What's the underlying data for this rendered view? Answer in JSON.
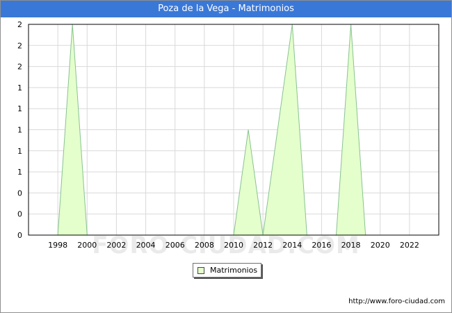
{
  "window": {
    "title": "Poza de la Vega - Matrimonios"
  },
  "watermark": "FORO-CIUDAD.COM",
  "source": "http://www.foro-ciudad.com",
  "colors": {
    "title_bar": "#3a78d8",
    "fill": "#e4ffcc",
    "line": "#88c291",
    "grid": "#d9d9d9"
  },
  "chart_data": {
    "type": "area",
    "title": "Poza de la Vega - Matrimonios",
    "xlabel": "",
    "ylabel": "",
    "x": [
      1996,
      1997,
      1998,
      1999,
      2000,
      2001,
      2002,
      2003,
      2004,
      2005,
      2006,
      2007,
      2008,
      2009,
      2010,
      2011,
      2012,
      2013,
      2014,
      2015,
      2016,
      2017,
      2018,
      2019,
      2020,
      2021,
      2022,
      2023
    ],
    "series": [
      {
        "name": "Matrimonios",
        "values": [
          null,
          null,
          0,
          2,
          0,
          null,
          null,
          null,
          null,
          null,
          null,
          null,
          null,
          null,
          0,
          1,
          0,
          1,
          2,
          0,
          null,
          0,
          2,
          0,
          null,
          null,
          null,
          null
        ]
      }
    ],
    "xlim": [
      1996,
      2024
    ],
    "ylim": [
      0,
      2
    ],
    "x_ticks": [
      "1998",
      "2000",
      "2002",
      "2004",
      "2006",
      "2008",
      "2010",
      "2012",
      "2014",
      "2016",
      "2018",
      "2020",
      "2022"
    ],
    "y_tick_labels": [
      "0",
      "0",
      "0",
      "1",
      "1",
      "1",
      "1",
      "1",
      "2",
      "2",
      "2"
    ],
    "grid": true,
    "legend": {
      "position": "bottom-center",
      "entries": [
        "Matrimonios"
      ]
    }
  }
}
